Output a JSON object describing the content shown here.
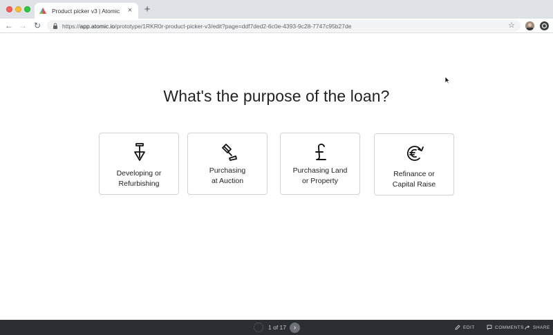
{
  "browser": {
    "tab_title": "Product picker v3 | Atomic",
    "tab_close": "×",
    "new_tab": "+",
    "url_scheme": "https://",
    "url_host": "app.atomic.io",
    "url_path": "/prototype/1RKR0r-product-picker-v3/edit?page=ddf7ded2-6c0e-4393-9c28-7747c95b27de",
    "back_icon": "←",
    "forward_icon": "→",
    "reload_icon": "↻",
    "star_icon": "☆"
  },
  "page": {
    "question": "What's the purpose of the loan?",
    "options": [
      {
        "label": "Developing or\nRefurbishing",
        "icon": "shovel-icon"
      },
      {
        "label": "Purchasing\nat Auction",
        "icon": "gavel-icon"
      },
      {
        "label": "Purchasing Land\nor Property",
        "icon": "pound-icon"
      },
      {
        "label": "Refinance or\nCapital Raise",
        "icon": "euro-refresh-icon"
      }
    ]
  },
  "footer": {
    "page_counter": "1 of 17",
    "next_icon": "›",
    "edit_label": "EDIT",
    "comments_label": "COMMENTS",
    "share_label": "SHARE"
  },
  "colors": {
    "tabstrip_bg": "#dee1e6",
    "card_border": "#d3d3d3",
    "bottombar_bg": "#2b2f33"
  }
}
